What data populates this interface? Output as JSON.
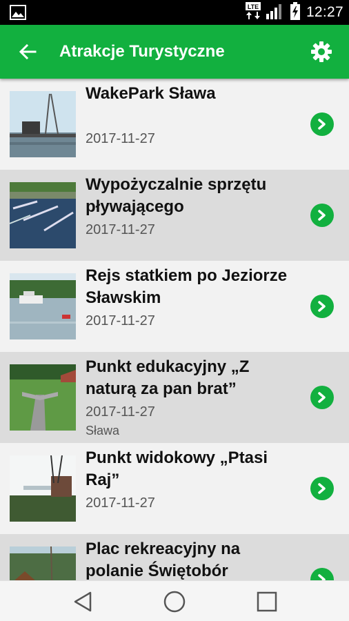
{
  "status_bar": {
    "network": "LTE",
    "time": "12:27",
    "icons": [
      "image-notification-icon",
      "lte-icon",
      "signal-icon",
      "battery-charging-icon"
    ]
  },
  "app_bar": {
    "title": "Atrakcje Turystyczne",
    "back_icon": "arrow-back-icon",
    "settings_icon": "gear-icon"
  },
  "colors": {
    "accent": "#12b03f",
    "row_light": "#f2f2f2",
    "row_dark": "#dcdcdc"
  },
  "items": [
    {
      "title": "WakePark Sława",
      "date": "2017-11-27",
      "place": ""
    },
    {
      "title": "Wypożyczalnie sprzętu pływającego",
      "date": "2017-11-27",
      "place": ""
    },
    {
      "title": "Rejs statkiem po Jeziorze Sławskim",
      "date": "2017-11-27",
      "place": ""
    },
    {
      "title": "Punkt edukacyjny „Z naturą za pan brat”",
      "date": "2017-11-27",
      "place": "Sława"
    },
    {
      "title": "Punkt widokowy „Ptasi Raj”",
      "date": "2017-11-27",
      "place": ""
    },
    {
      "title": "Plac rekreacyjny na polanie Świętobór",
      "date": "",
      "place": ""
    }
  ],
  "nav_bar": {
    "back": "nav-back-icon",
    "home": "nav-home-icon",
    "recents": "nav-recents-icon"
  }
}
